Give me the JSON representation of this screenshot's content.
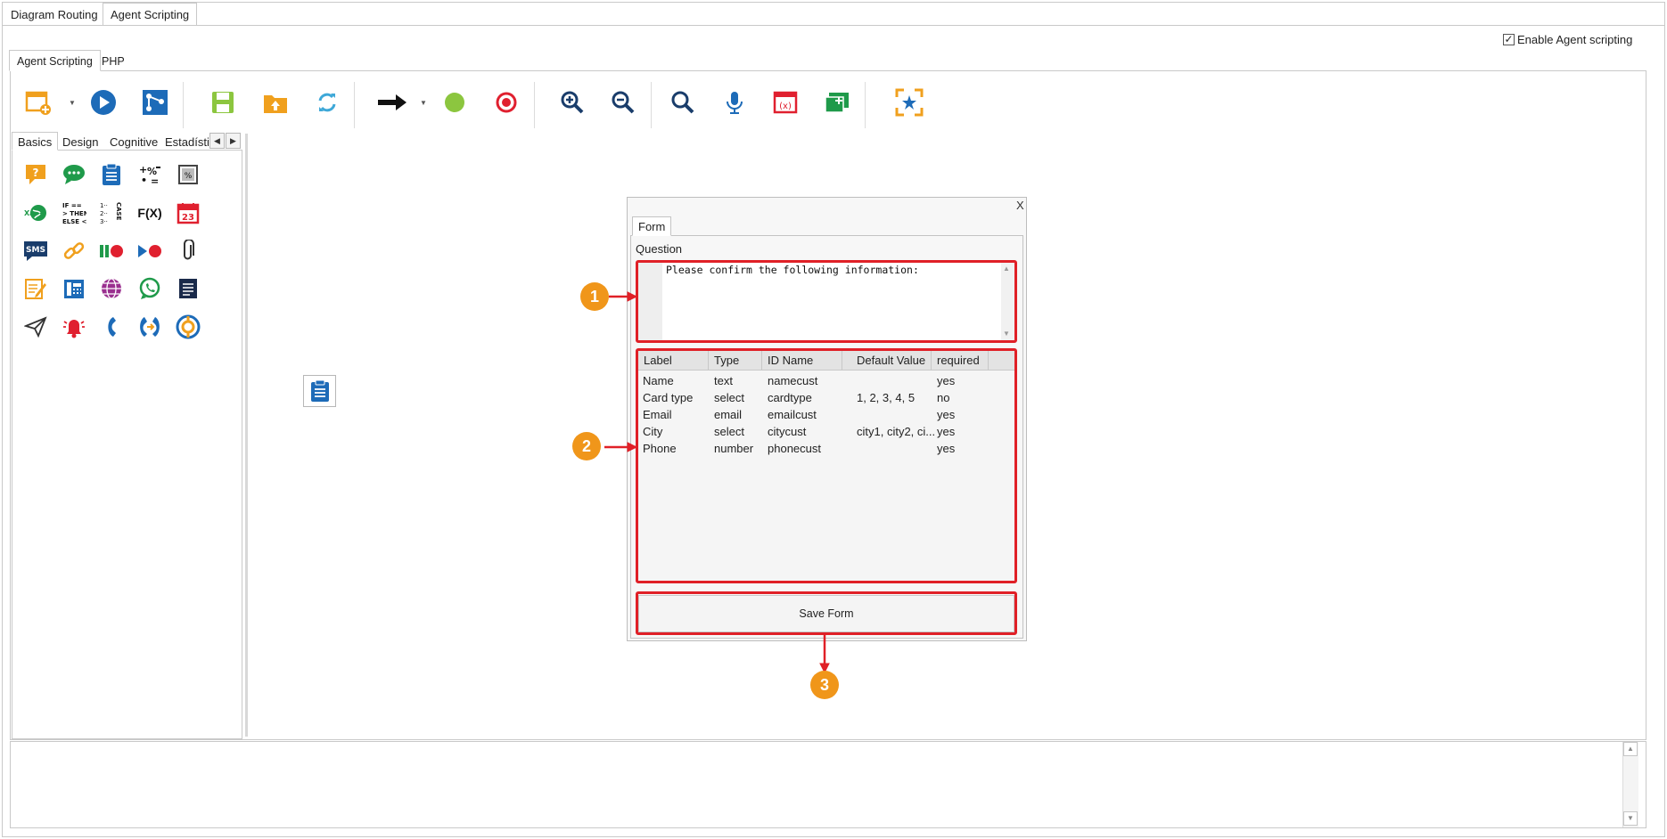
{
  "top_tabs": [
    {
      "label": "Diagram Routing",
      "active": false
    },
    {
      "label": "Agent Scripting",
      "active": true
    }
  ],
  "enable_agent_scripting": {
    "label": "Enable Agent scripting",
    "checked": true,
    "check_mark": "✓"
  },
  "inner_tabs": [
    {
      "label": "Agent Scripting",
      "active": true
    },
    {
      "label": "PHP",
      "active": false
    }
  ],
  "toolbar": {
    "icons": [
      "new-script-icon",
      "run-icon",
      "flow-diagram-icon",
      "save-icon",
      "open-folder-icon",
      "refresh-icon",
      "connector-arrow-icon",
      "start-node-icon",
      "end-node-icon",
      "zoom-in-icon",
      "zoom-out-icon",
      "search-icon",
      "microphone-icon",
      "variables-icon",
      "add-folder-icon",
      "fit-to-screen-icon"
    ]
  },
  "palette": {
    "tabs": [
      {
        "label": "Basics",
        "active": true
      },
      {
        "label": "Design",
        "active": false
      },
      {
        "label": "Cognitive",
        "active": false
      },
      {
        "label": "Estadísti",
        "active": false
      }
    ],
    "scroll_left": "◀",
    "scroll_right": "▶",
    "icons": [
      "question-bubble-icon",
      "chat-bubble-icon",
      "clipboard-form-icon",
      "math-operations-icon",
      "percentage-calc-icon",
      "web-service-icon",
      "if-then-else-icon",
      "case-icon",
      "function-fx-icon",
      "calendar-icon",
      "sms-icon",
      "link-icon",
      "pause-record-icon",
      "play-record-icon",
      "attachment-icon",
      "note-edit-icon",
      "phone-book-icon",
      "globe-icon",
      "whatsapp-icon",
      "document-icon",
      "send-icon",
      "alarm-bell-icon",
      "phone-call-icon",
      "call-transfer-icon",
      "support-icon"
    ],
    "labels": {
      "fx": "F(X)",
      "calendar_day": "23",
      "sms": "SMS",
      "if_then": "IF ==\n> THEN\nELSE <",
      "case": "CASE"
    }
  },
  "canvas": {
    "node_icon": "clipboard-form-icon"
  },
  "form_dialog": {
    "close_label": "X",
    "tab_label": "Form",
    "question_label": "Question",
    "question_text": "Please confirm the following information:",
    "columns": [
      "Label",
      "Type",
      "ID Name",
      "Default Value",
      "required"
    ],
    "rows": [
      [
        "Name",
        "text",
        "namecust",
        "",
        "yes"
      ],
      [
        "Card type",
        "select",
        "cardtype",
        "1, 2, 3, 4, 5",
        "no"
      ],
      [
        "Email",
        "email",
        "emailcust",
        "",
        "yes"
      ],
      [
        "City",
        "select",
        "citycust",
        "city1, city2, ci...",
        "yes"
      ],
      [
        "Phone",
        "number",
        "phonecust",
        "",
        "yes"
      ]
    ],
    "save_label": "Save Form"
  },
  "annotations": [
    "1",
    "2",
    "3"
  ],
  "colors": {
    "highlight_red": "#e02027",
    "marker_orange": "#f0961a",
    "accent_blue": "#1d6bb8"
  }
}
